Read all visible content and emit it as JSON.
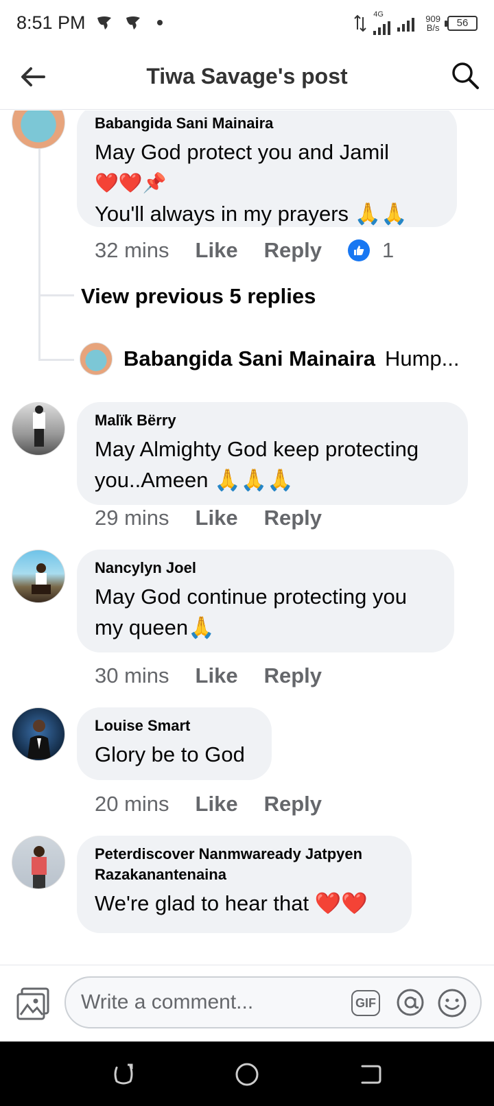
{
  "status_bar": {
    "time": "8:51 PM",
    "network": "4G",
    "speed_value": "909",
    "speed_unit": "B/s",
    "battery": "56"
  },
  "header": {
    "title": "Tiwa Savage's post",
    "back_icon": "arrow-left-icon",
    "search_icon": "search-icon"
  },
  "comments": [
    {
      "author": "Babangida Sani Mainaira",
      "lines": [
        "May God protect you and Jamil",
        "❤️❤️📌",
        "You'll always in my prayers 🙏🙏"
      ],
      "time": "32 mins",
      "like_label": "Like",
      "reply_label": "Reply",
      "reaction_count": "1"
    },
    {
      "author": "Malïk Bërry",
      "lines": [
        "May Almighty God keep protecting",
        "you..Ameen 🙏🙏🙏"
      ],
      "time": "29 mins",
      "like_label": "Like",
      "reply_label": "Reply"
    },
    {
      "author": "Nancylyn Joel",
      "lines": [
        "May God continue protecting you",
        "my queen🙏"
      ],
      "time": "30 mins",
      "like_label": "Like",
      "reply_label": "Reply"
    },
    {
      "author": "Louise Smart",
      "lines": [
        "Glory be to God"
      ],
      "time": "20 mins",
      "like_label": "Like",
      "reply_label": "Reply"
    },
    {
      "author_line1": "Peterdiscover Nanmwaready Jatpyen",
      "author_line2": "Razakanantenaina",
      "lines": [
        "We're glad to hear that ❤️❤️"
      ]
    }
  ],
  "thread": {
    "view_previous": "View previous 5 replies",
    "collapsed_author": "Babangida Sani Mainaira",
    "collapsed_preview": "Hump..."
  },
  "composer": {
    "placeholder": "Write a comment...",
    "gif_label": "GIF"
  },
  "colors": {
    "bubble": "#f0f2f5",
    "secondary_text": "#65676b",
    "like_blue": "#1877f2"
  }
}
